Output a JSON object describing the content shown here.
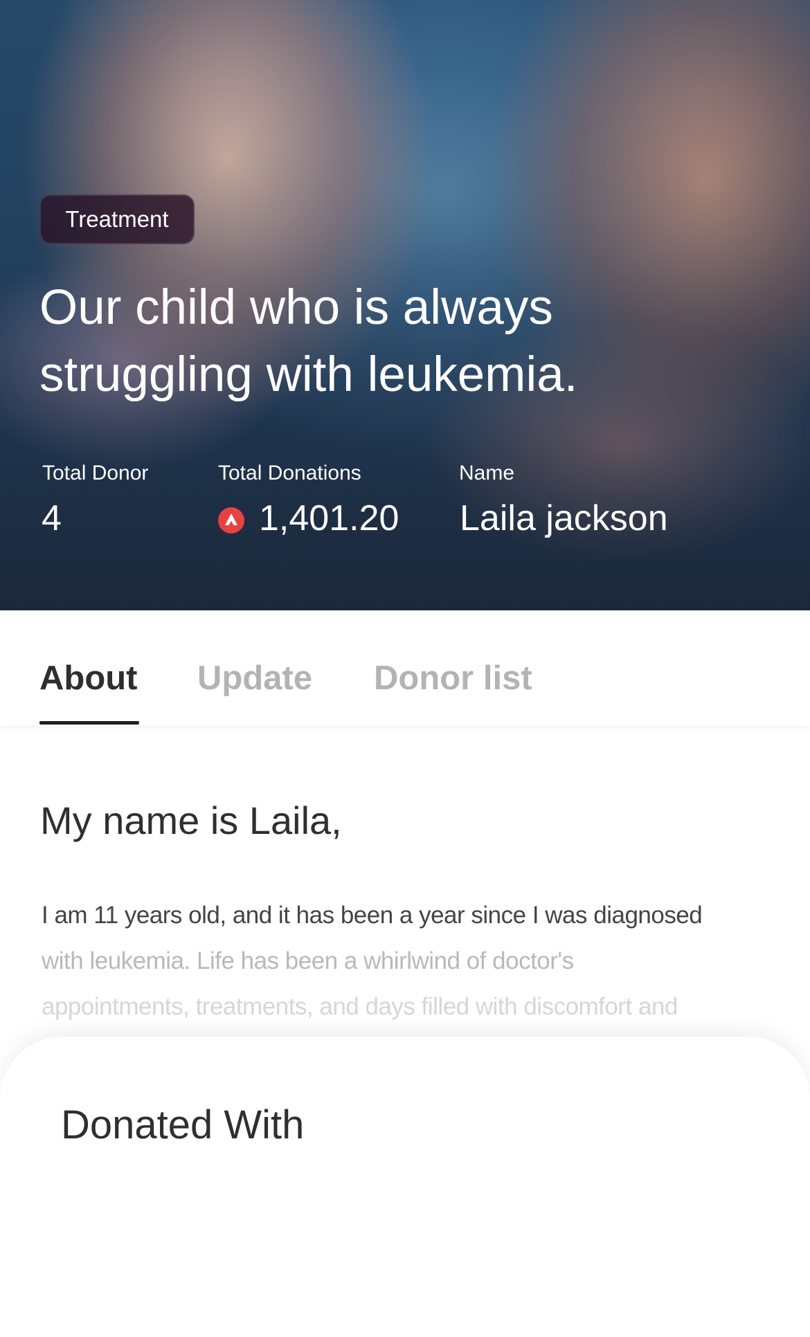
{
  "hero": {
    "category_badge": "Treatment",
    "title": "Our child who is always struggling with leukemia.",
    "stats": {
      "total_donor_label": "Total Donor",
      "total_donor_value": "4",
      "total_donations_label": "Total Donations",
      "total_donations_value": "1,401.20",
      "currency_icon": "avalanche-coin-icon",
      "name_label": "Name",
      "name_value": "Laila jackson"
    }
  },
  "tabs": [
    {
      "label": "About",
      "active": true
    },
    {
      "label": "Update",
      "active": false
    },
    {
      "label": "Donor list",
      "active": false
    }
  ],
  "about": {
    "heading": "My name is Laila,",
    "body_line1": "I am 11 years old, and it has been a year since I was diagnosed",
    "body_line2": "with leukemia. Life has been a whirlwind of doctor's",
    "body_line3": "appointments, treatments, and days filled with discomfort and"
  },
  "sheet": {
    "title": "Donated With"
  },
  "colors": {
    "coin": "#e84142",
    "active_tab": "#2e2e2e",
    "inactive_tab": "#b3b3b3"
  }
}
